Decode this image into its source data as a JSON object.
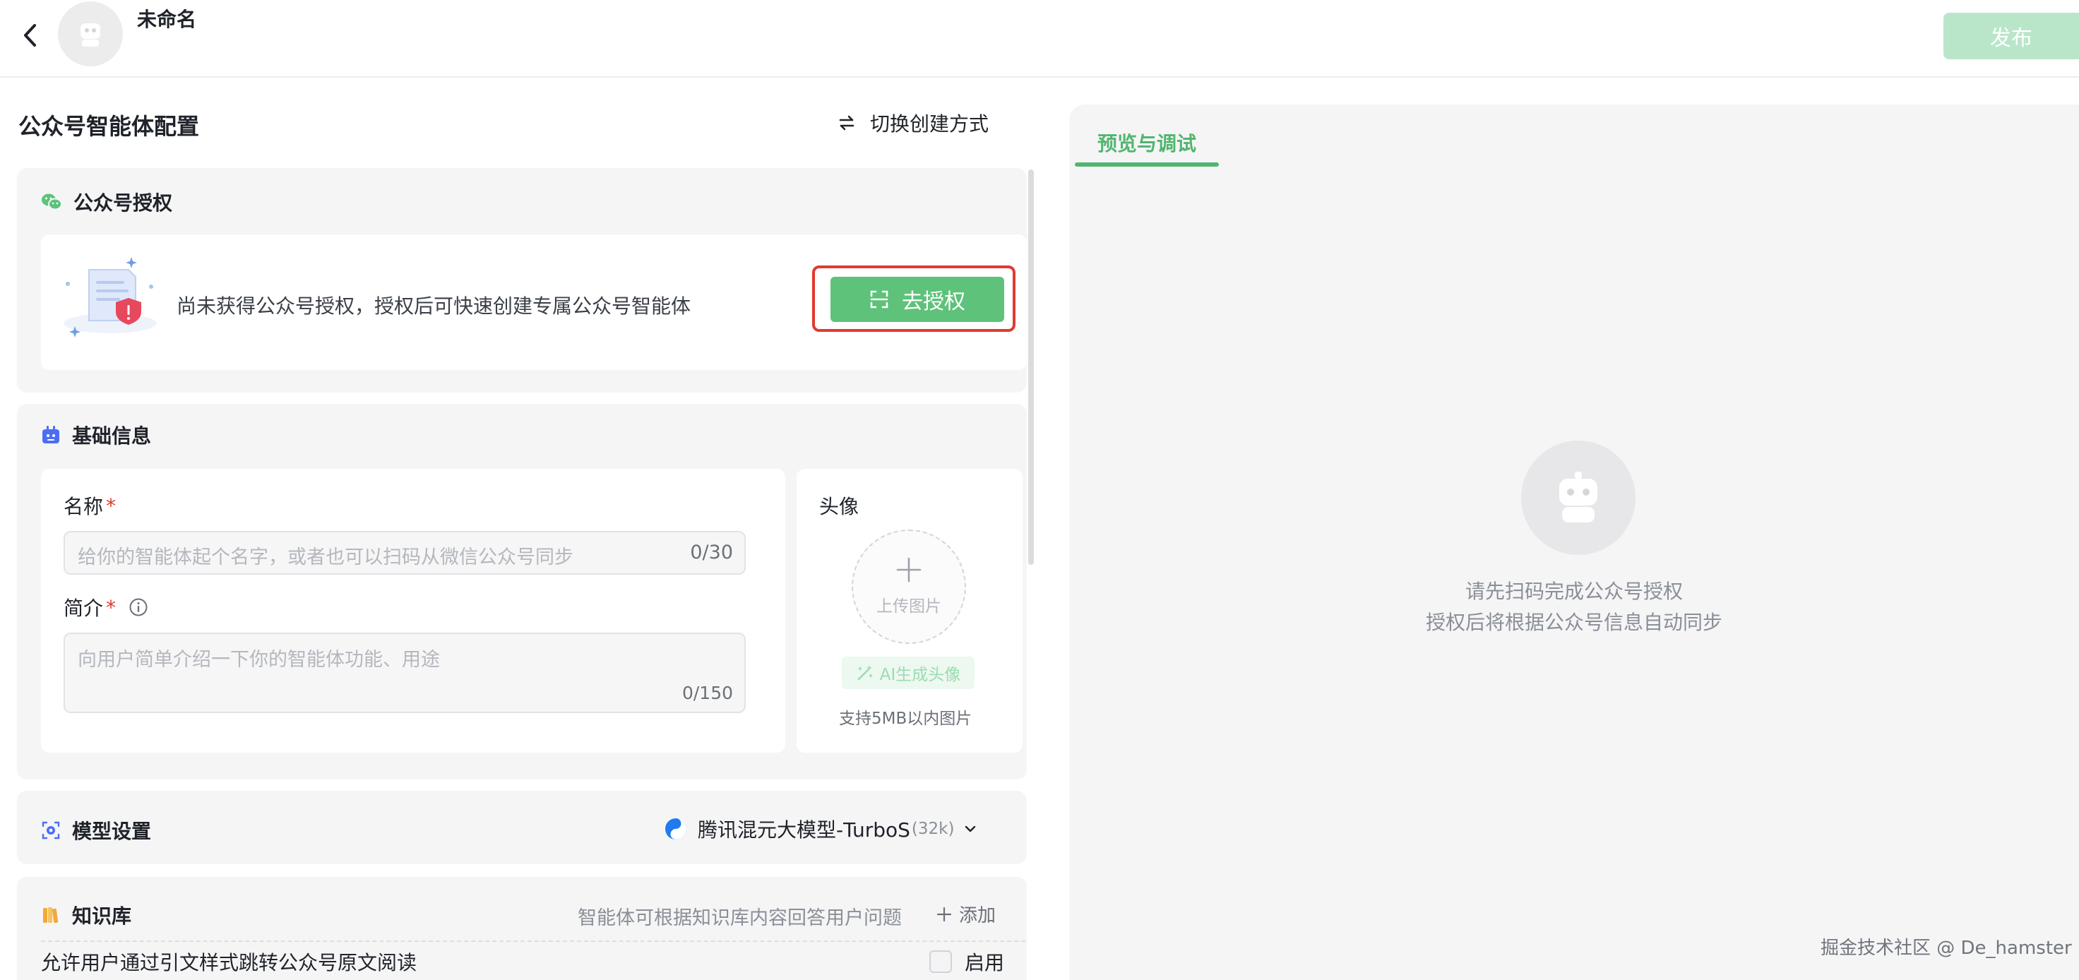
{
  "header": {
    "title": "未命名",
    "publish_label": "发布"
  },
  "config": {
    "title": "公众号智能体配置",
    "switch_label": "切换创建方式"
  },
  "auth_card": {
    "title": "公众号授权",
    "message": "尚未获得公众号授权，授权后可快速创建专属公众号智能体",
    "button_label": "去授权"
  },
  "basic_info": {
    "title": "基础信息",
    "name_label": "名称",
    "name_placeholder": "给你的智能体起个名字，或者也可以扫码从微信公众号同步",
    "name_counter": "0/30",
    "intro_label": "简介",
    "intro_placeholder": "向用户简单介绍一下你的智能体功能、用途",
    "intro_counter": "0/150",
    "required_mark": "*",
    "avatar_label": "头像",
    "upload_label": "上传图片",
    "ai_avatar_label": "AI生成头像",
    "upload_hint": "支持5MB以内图片"
  },
  "model": {
    "title": "模型设置",
    "selected": "腾讯混元大模型-TurboS",
    "context": "(32k)"
  },
  "knowledge": {
    "title": "知识库",
    "description": "智能体可根据知识库内容回答用户问题",
    "add_label": "添加"
  },
  "jump_option": {
    "text": "允许用户通过引文样式跳转公众号原文阅读",
    "toggle_label": "启用",
    "checked": false
  },
  "preview": {
    "tab_label": "预览与调试",
    "empty_line1": "请先扫码完成公众号授权",
    "empty_line2": "授权后将根据公众号信息自动同步"
  },
  "watermark": "掘金技术社区 @ De_hamster",
  "colors": {
    "brand_green": "#5ec27a",
    "tab_green": "#52b56f",
    "highlight_red": "#e03a2e",
    "publish_disabled": "#b9e6c9"
  }
}
